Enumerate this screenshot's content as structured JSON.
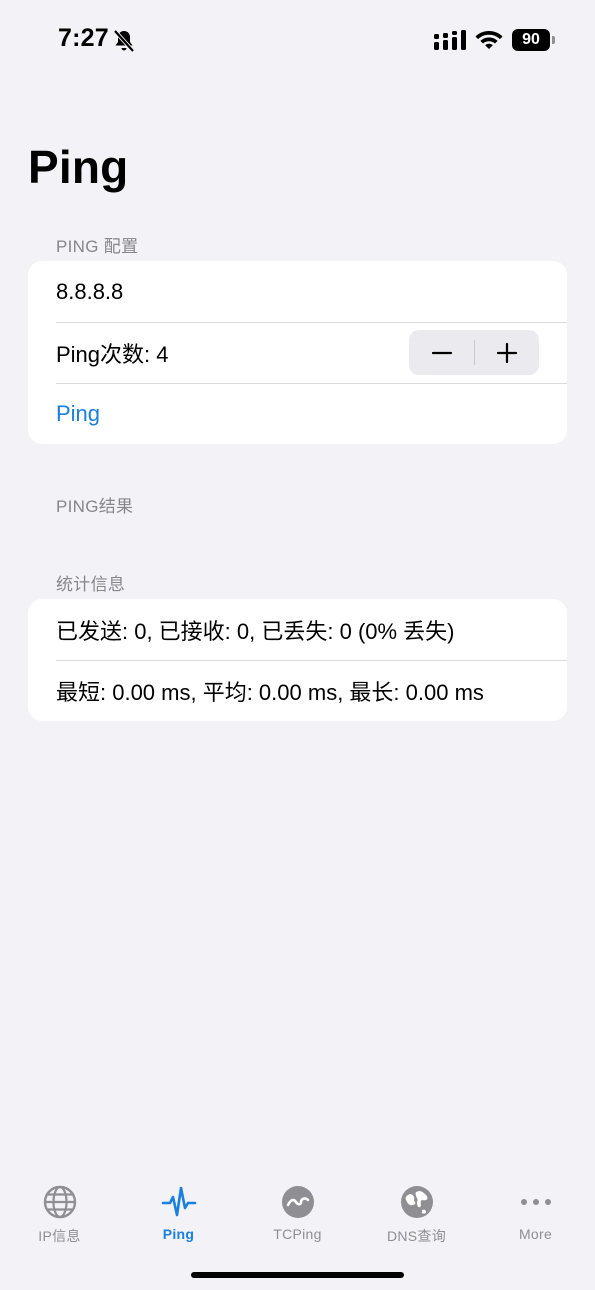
{
  "status_bar": {
    "time": "7:27",
    "battery": "90",
    "icons": [
      "bell-slash-icon",
      "cellular-signal-icon",
      "wifi-icon",
      "battery-icon"
    ]
  },
  "page_title": "Ping",
  "config_section": {
    "header": "PING 配置",
    "host_value": "8.8.8.8",
    "count_label": "Ping次数: 4",
    "ping_button": "Ping"
  },
  "results_section": {
    "header": "PING结果"
  },
  "stats_section": {
    "header": "统计信息",
    "summary": "已发送: 0, 已接收: 0, 已丢失: 0 (0% 丢失)",
    "timing": "最短: 0.00 ms, 平均: 0.00 ms, 最长: 0.00 ms"
  },
  "tabs": [
    {
      "label": "IP信息",
      "icon": "globe-icon"
    },
    {
      "label": "Ping",
      "icon": "waveform-icon"
    },
    {
      "label": "TCPing",
      "icon": "wave-circle-icon"
    },
    {
      "label": "DNS查询",
      "icon": "globe-asia-icon"
    },
    {
      "label": "More",
      "icon": "ellipsis-icon"
    }
  ],
  "colors": {
    "accent": "#1A7FDD",
    "background": "#F2F2F7",
    "secondary_text": "#86868B"
  }
}
